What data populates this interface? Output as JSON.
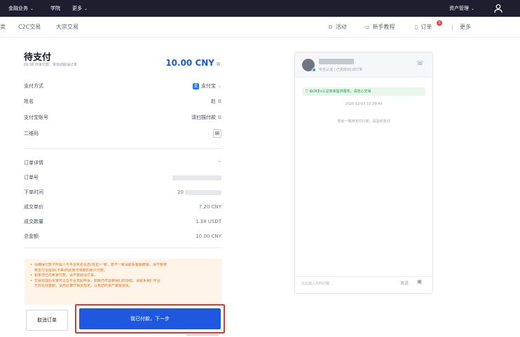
{
  "topbar": {
    "items": [
      {
        "label": "金融业务",
        "has_chevron": true
      },
      {
        "label": "学院",
        "has_chevron": false
      },
      {
        "label": "更多",
        "has_chevron": true
      }
    ],
    "assets_label": "资产管理",
    "user_icon": "user-icon"
  },
  "subnav": {
    "left_cut": "卖",
    "tabs": [
      "C2C交易",
      "大宗交易"
    ],
    "right": [
      {
        "icon": "activity-icon",
        "label": "活动"
      },
      {
        "icon": "book-icon",
        "label": "新手教程"
      },
      {
        "icon": "orders-icon",
        "label": "订单",
        "badge": "1"
      },
      {
        "icon": "more-icon",
        "label": "更多"
      }
    ]
  },
  "order": {
    "title": "待支付",
    "subtitle": "09:38 内未付款，将自动取消订单",
    "amount": "10.00 CNY",
    "payment_method_label": "支付方式",
    "payment_method_value": "支付宝",
    "payment_method_icon_text": "支",
    "name_label": "姓名",
    "name_value": "赵",
    "account_label": "支付宝账号",
    "account_value": "请扫描付款",
    "qr_label": "二维码",
    "qr_icon_text": "⊞"
  },
  "details": {
    "section_label": "订单详情",
    "rows": [
      {
        "label": "订单号",
        "value": ""
      },
      {
        "label": "下单时间",
        "value": "20"
      },
      {
        "label": "成交单价",
        "value": "7.20 CNY"
      },
      {
        "label": "成交数量",
        "value": "1.38 USDT"
      },
      {
        "label": "总金额",
        "value": "10.00 CNY"
      }
    ]
  },
  "notice": {
    "lines": [
      "请确保付款卡所属人与平台实名信息(姓名)一致，若不一致请联系客服撤销，请不要使",
      "用支付宝提现(卡等)向此账号转账的账户付款。",
      "如果您已向卖家付款，请不要取消订单。",
      "交易完成后买家可以在平台发起申诉，如果仍然需要我们的协助，请联系我们平台",
      "方的在线客服，请务必遵守相关规定，以免您的资产遭受损失。"
    ]
  },
  "buttons": {
    "cancel": "取消订单",
    "confirm": "我已付款，下一步"
  },
  "chat": {
    "meta": "实名认证 | 已完成90,657单",
    "verified_text": "由OKEx认证商家提供服务，请放心交易",
    "timestamp": "2020-12-03 10:39:49",
    "system_message": "您有一笔待支付订单，请及时支付",
    "input_placeholder": "在此输入你的问题...",
    "send_label": "发送",
    "image_icon_text": "▣",
    "phone_icon_text": "☏"
  },
  "colors": {
    "topbar_bg": "#1b1f2e",
    "accent_blue": "#1e58e0",
    "amount_blue": "#1f5bd6",
    "highlight_red": "#e2372c",
    "notice_text": "#e0701a",
    "notice_bg": "#fff4e8"
  }
}
